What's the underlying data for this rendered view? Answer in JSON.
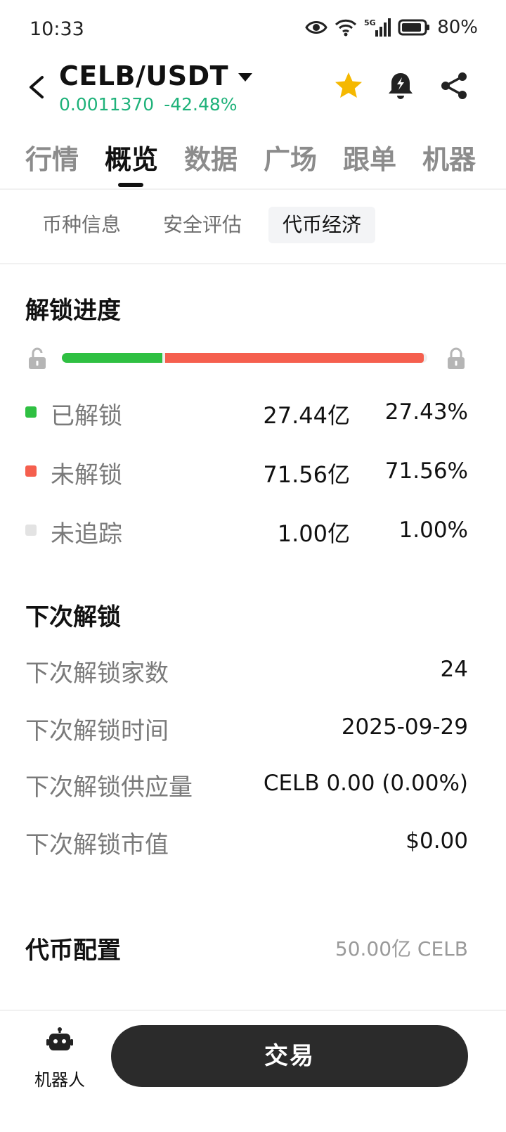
{
  "status_bar": {
    "time": "10:33",
    "network": "5G",
    "battery": "80%"
  },
  "header": {
    "pair": "CELB/USDT",
    "price": "0.0011370",
    "change": "-42.48%",
    "colors": {
      "up": "#1fb27a",
      "favorite": "#f5b800"
    }
  },
  "main_tabs": [
    "行情",
    "概览",
    "数据",
    "广场",
    "跟单",
    "机器"
  ],
  "active_main_tab": "概览",
  "sub_tabs": [
    "币种信息",
    "安全评估",
    "代币经济"
  ],
  "active_sub_tab": "代币经济",
  "unlock_progress": {
    "title": "解锁进度",
    "unlocked_fraction": 0.2743,
    "locked_fraction": 0.7156,
    "untracked_fraction": 0.01,
    "legend": [
      {
        "label": "已解锁",
        "amount": "27.44亿",
        "percent": "27.43%",
        "color": "#2fc042"
      },
      {
        "label": "未解锁",
        "amount": "71.56亿",
        "percent": "71.56%",
        "color": "#f55f4e"
      },
      {
        "label": "未追踪",
        "amount": "1.00亿",
        "percent": "1.00%",
        "color": "#e3e3e3"
      }
    ]
  },
  "next_unlock": {
    "title": "下次解锁",
    "rows": [
      {
        "label": "下次解锁家数",
        "value": "24"
      },
      {
        "label": "下次解锁时间",
        "value": "2025-09-29"
      },
      {
        "label": "下次解锁供应量",
        "value": "CELB 0.00 (0.00%)"
      },
      {
        "label": "下次解锁市值",
        "value": "$0.00"
      }
    ]
  },
  "token_config": {
    "title": "代币配置",
    "value": "50.00亿 CELB"
  },
  "bottom_bar": {
    "bot_label": "机器人",
    "trade_label": "交易"
  }
}
